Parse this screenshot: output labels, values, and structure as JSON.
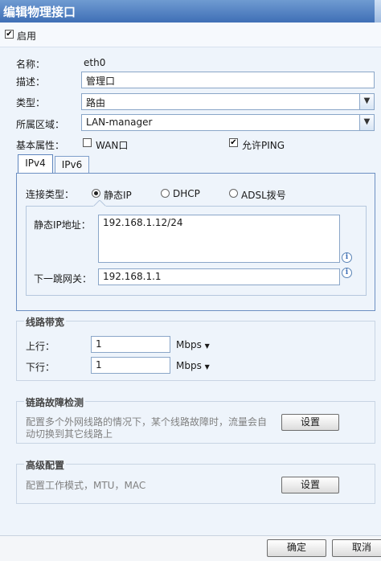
{
  "window": {
    "title": "编辑物理接口"
  },
  "enable": {
    "label": "启用",
    "checked": true
  },
  "form": {
    "name_label": "名称：",
    "name_value": "eth0",
    "desc_label": "描述：",
    "desc_value": "管理口",
    "type_label": "类型：",
    "type_value": "路由",
    "zone_label": "所属区域：",
    "zone_value": "LAN-manager",
    "attr_label": "基本属性：",
    "wan_label": "WAN口",
    "wan_checked": false,
    "ping_label": "允许PING",
    "ping_checked": true
  },
  "tabs": [
    {
      "label": "IPv4",
      "active": true
    },
    {
      "label": "IPv6",
      "active": false
    }
  ],
  "ipv4": {
    "conn_type_label": "连接类型：",
    "options": [
      {
        "label": "静态IP",
        "selected": true
      },
      {
        "label": "DHCP",
        "selected": false
      },
      {
        "label": "ADSL拨号",
        "selected": false
      }
    ],
    "static_ip_label": "静态IP地址：",
    "static_ip_value": "192.168.1.12/24",
    "gateway_label": "下一跳网关：",
    "gateway_value": "192.168.1.1"
  },
  "bandwidth": {
    "title": "线路带宽",
    "up_label": "上行：",
    "up_value": "1",
    "up_unit": "Mbps",
    "down_label": "下行：",
    "down_value": "1",
    "down_unit": "Mbps"
  },
  "fault": {
    "title": "链路故障检测",
    "desc_line1": "配置多个外网线路的情况下，某个线路故障时，流量会自",
    "desc_line2": "动切换到其它线路上",
    "button": "设置"
  },
  "advanced": {
    "title": "高级配置",
    "desc": "配置工作模式，MTU，MAC",
    "button": "设置"
  },
  "footer": {
    "ok": "确定",
    "cancel": "取消"
  },
  "icons": {
    "checkbox_checked": "checkmark",
    "dropdown": "chevron-down-icon",
    "info": "info-icon",
    "unit_dropdown": "caret-down-icon"
  },
  "colors": {
    "titlebar": "#3f6fb6",
    "panel_border": "#6c8fc2",
    "background": "#eef4fb"
  }
}
